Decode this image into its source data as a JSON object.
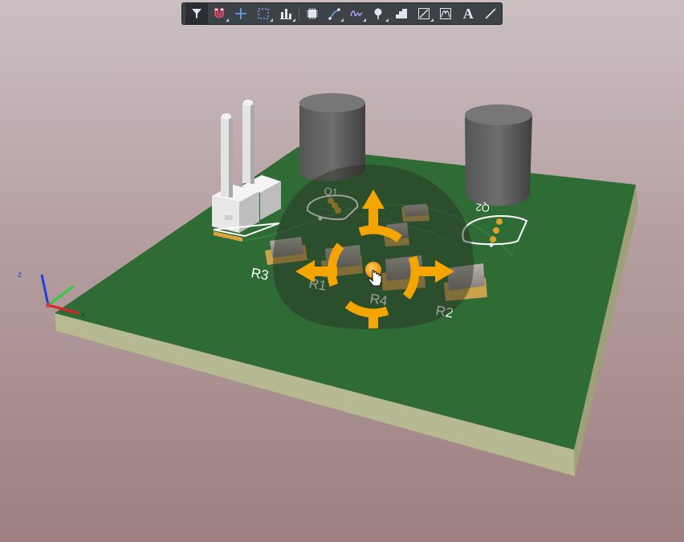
{
  "toolbar": {
    "tools": [
      {
        "name": "filter-tool",
        "icon": "filter-icon"
      },
      {
        "name": "snap-tool",
        "icon": "magnet-icon"
      },
      {
        "name": "crosshair-tool",
        "icon": "plus-icon"
      },
      {
        "name": "select-area-tool",
        "icon": "dashed-rect-icon"
      },
      {
        "name": "align-tool",
        "icon": "bar-chart-icon"
      },
      {
        "name": "component-tool",
        "icon": "chip-icon"
      },
      {
        "name": "route-tool",
        "icon": "route-icon"
      },
      {
        "name": "tune-tool",
        "icon": "wave-icon"
      },
      {
        "name": "probe-tool",
        "icon": "pin-icon"
      },
      {
        "name": "layer-tool",
        "icon": "stack-icon"
      },
      {
        "name": "graph-tool",
        "icon": "graph-icon"
      },
      {
        "name": "measure-tool",
        "icon": "curve-box-icon"
      },
      {
        "name": "text-tool",
        "icon": "text-icon",
        "label": "A"
      },
      {
        "name": "line-tool",
        "icon": "line-icon"
      }
    ]
  },
  "designators": {
    "r1": "R1",
    "r2": "R2",
    "r3": "R3",
    "r4": "R4",
    "q1": "Q1",
    "q2": "Q2"
  },
  "colors": {
    "board_top": "#2f6b35",
    "board_edge": "#a6aa82",
    "gizmo": "#f5a500",
    "transistor": "#5a5a5a"
  }
}
